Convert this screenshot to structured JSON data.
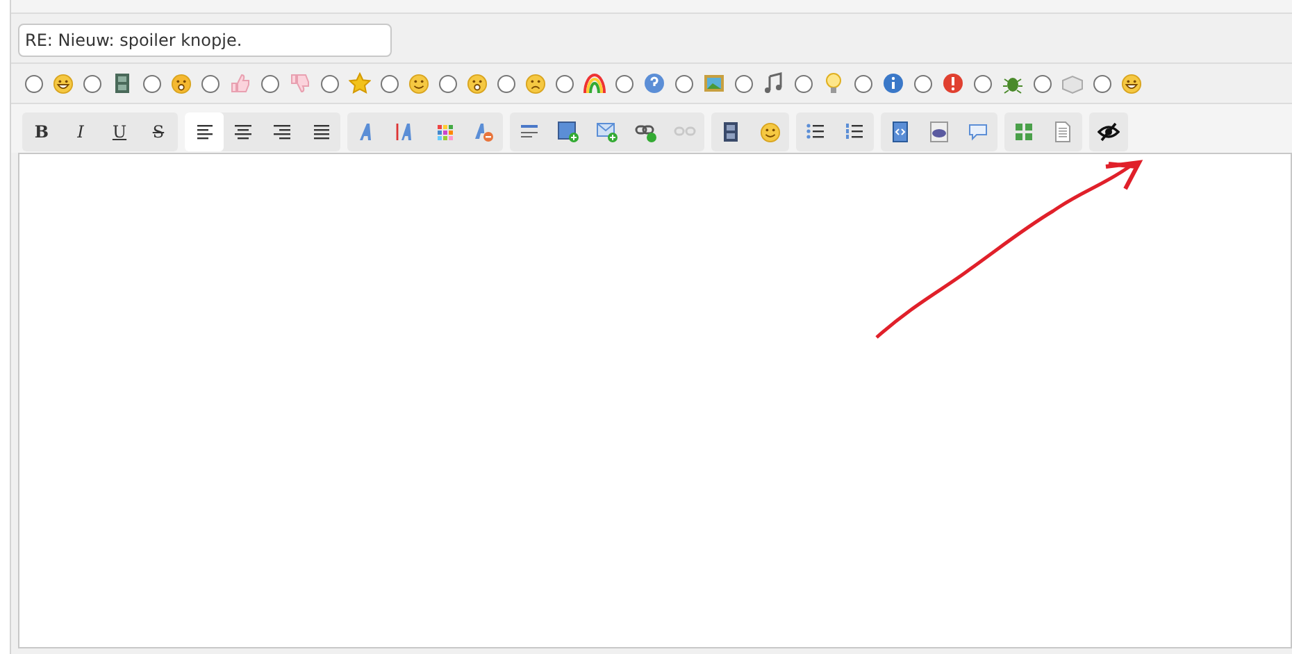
{
  "subject": {
    "value": "RE: Nieuw: spoiler knopje."
  },
  "smilies": [
    {
      "selected": false
    },
    {
      "selected": false
    },
    {
      "selected": false
    },
    {
      "selected": false
    },
    {
      "selected": false
    },
    {
      "selected": false
    },
    {
      "selected": false
    },
    {
      "selected": false
    },
    {
      "selected": false
    },
    {
      "selected": false
    },
    {
      "selected": false
    },
    {
      "selected": false
    },
    {
      "selected": false
    },
    {
      "selected": false
    },
    {
      "selected": false
    },
    {
      "selected": false
    },
    {
      "selected": false
    },
    {
      "selected": false
    },
    {
      "selected": false
    }
  ],
  "toolbar": [
    {
      "buttons": [
        {
          "kind": "text",
          "label": "B",
          "selected": false
        },
        {
          "kind": "text",
          "label": "I",
          "selected": false
        },
        {
          "kind": "text",
          "label": "U",
          "selected": false
        },
        {
          "kind": "text",
          "label": "S",
          "selected": false
        }
      ]
    },
    {
      "buttons": [
        {
          "kind": "icon",
          "selected": true
        },
        {
          "kind": "icon",
          "selected": false
        },
        {
          "kind": "icon",
          "selected": false
        },
        {
          "kind": "icon",
          "selected": false
        }
      ]
    },
    {
      "buttons": [
        {
          "kind": "icon",
          "selected": false
        },
        {
          "kind": "icon",
          "selected": false
        },
        {
          "kind": "icon",
          "selected": false
        },
        {
          "kind": "icon",
          "selected": false
        }
      ]
    },
    {
      "buttons": [
        {
          "kind": "icon",
          "selected": false
        },
        {
          "kind": "icon",
          "selected": false
        },
        {
          "kind": "icon",
          "selected": false
        },
        {
          "kind": "icon",
          "selected": false
        },
        {
          "kind": "icon",
          "selected": false,
          "disabled": true
        }
      ]
    },
    {
      "buttons": [
        {
          "kind": "icon",
          "selected": false
        },
        {
          "kind": "icon",
          "selected": false
        }
      ]
    },
    {
      "buttons": [
        {
          "kind": "icon",
          "selected": false
        },
        {
          "kind": "icon",
          "selected": false
        }
      ]
    },
    {
      "buttons": [
        {
          "kind": "icon",
          "selected": false
        },
        {
          "kind": "icon",
          "selected": false
        },
        {
          "kind": "icon",
          "selected": false
        }
      ]
    },
    {
      "buttons": [
        {
          "kind": "icon",
          "selected": false
        },
        {
          "kind": "icon",
          "selected": false
        }
      ]
    },
    {
      "buttons": [
        {
          "kind": "icon",
          "selected": false
        }
      ]
    }
  ]
}
